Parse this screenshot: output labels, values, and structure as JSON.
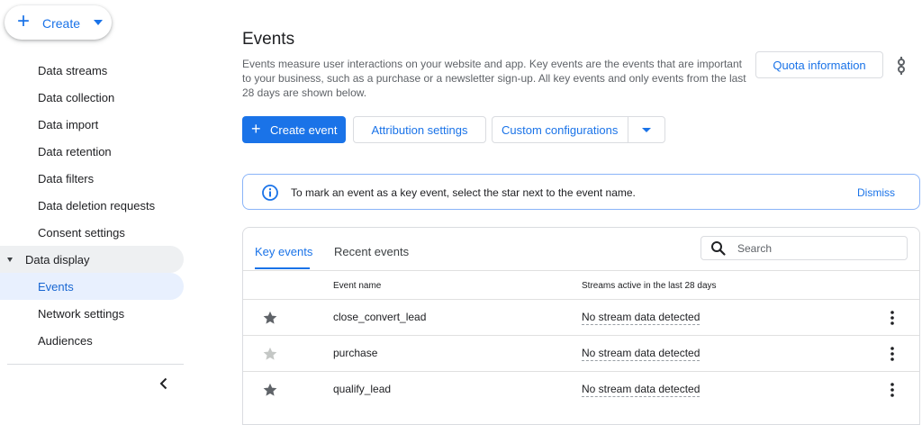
{
  "sidebar": {
    "create_label": "Create",
    "items": [
      {
        "label": "Data streams"
      },
      {
        "label": "Data collection"
      },
      {
        "label": "Data import"
      },
      {
        "label": "Data retention"
      },
      {
        "label": "Data filters"
      },
      {
        "label": "Data deletion requests"
      },
      {
        "label": "Consent settings"
      },
      {
        "label": "Data display"
      },
      {
        "label": "Events"
      },
      {
        "label": "Network settings"
      },
      {
        "label": "Audiences"
      }
    ],
    "section_item": "Data display",
    "active_item": "Events"
  },
  "header": {
    "title": "Events",
    "description": "Events measure user interactions on your website and app. Key events are the events that are important to your business, such as a purchase or a newsletter sign-up. All key events and only events from the last 28 days are shown below.",
    "quota_label": "Quota information"
  },
  "toolbar": {
    "create_event_label": "Create event",
    "attribution_label": "Attribution settings",
    "custom_config_label": "Custom configurations"
  },
  "banner": {
    "message": "To mark an event as a key event, select the star next to the event name.",
    "dismiss_label": "Dismiss"
  },
  "table": {
    "tabs": [
      {
        "label": "Key events",
        "active": true
      },
      {
        "label": "Recent events",
        "active": false
      }
    ],
    "search_placeholder": "Search",
    "columns": {
      "event_name": "Event name",
      "streams": "Streams active in the last 28 days"
    },
    "rows": [
      {
        "name": "close_convert_lead",
        "stream_status": "No stream data detected",
        "key_event": true
      },
      {
        "name": "purchase",
        "stream_status": "No stream data detected",
        "key_event": false
      },
      {
        "name": "qualify_lead",
        "stream_status": "No stream data detected",
        "key_event": true
      }
    ]
  },
  "colors": {
    "accent": "#1a73e8",
    "star_on": "#5f6368",
    "star_off": "#c4c7c5"
  }
}
